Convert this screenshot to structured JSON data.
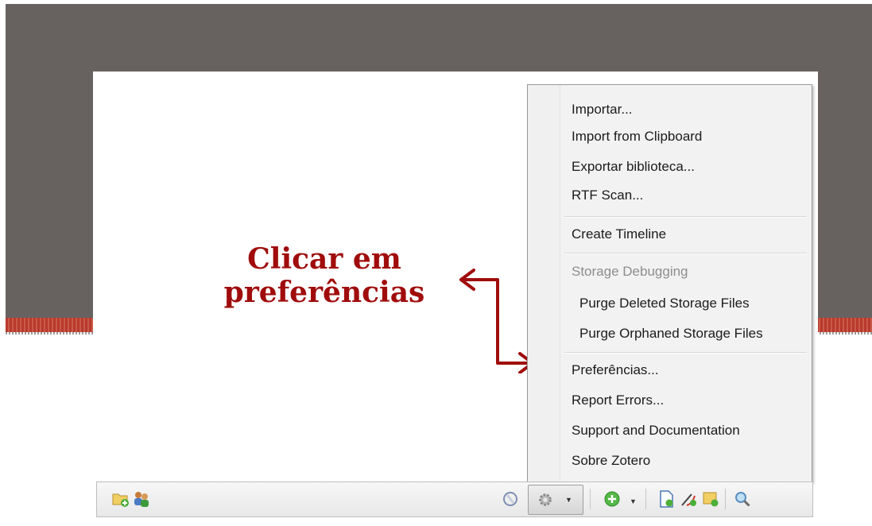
{
  "annotation": {
    "line1": "Clicar em",
    "line2": "preferências",
    "color": "#a00c0c"
  },
  "menu": {
    "items": [
      {
        "label": "Importar..."
      },
      {
        "label": "Import from Clipboard"
      },
      {
        "label": "Exportar biblioteca..."
      },
      {
        "label": "RTF Scan..."
      },
      {
        "label": "Create Timeline"
      },
      {
        "label": "Storage Debugging",
        "disabled": true
      },
      {
        "label": "Purge Deleted Storage Files"
      },
      {
        "label": "Purge Orphaned Storage Files"
      },
      {
        "label": "Preferências..."
      },
      {
        "label": "Report Errors..."
      },
      {
        "label": "Support and Documentation"
      },
      {
        "label": "Sobre Zotero"
      }
    ]
  },
  "toolbar": {
    "left_icons": [
      "new-collection-icon",
      "new-group-icon"
    ],
    "right_icons": [
      "sync-icon",
      "gear-icon",
      "add-item-icon",
      "new-note-icon",
      "attach-link-icon",
      "attachment-icon",
      "search-icon"
    ]
  },
  "colors": {
    "slide_band": "#676260",
    "stripe": "#b83a2c",
    "accent_red": "#a00c0c"
  }
}
